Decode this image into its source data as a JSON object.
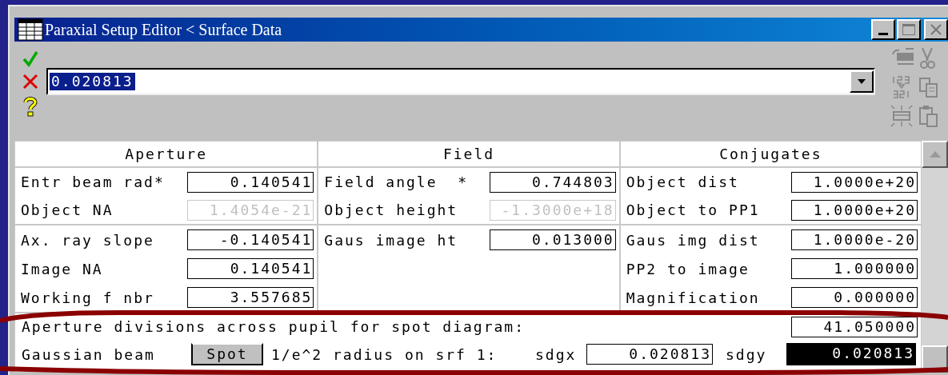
{
  "window": {
    "title": "Paraxial Setup Editor < Surface Data"
  },
  "edit_bar": {
    "value": "0.020813",
    "selected": true
  },
  "sections": [
    {
      "title": "Aperture",
      "groups": [
        [
          {
            "label": "Entr beam rad*",
            "value": "0.140541",
            "disabled": false
          },
          {
            "label": "Object NA",
            "value": "1.4054e-21",
            "disabled": true
          }
        ],
        [
          {
            "label": "Ax. ray slope",
            "value": "-0.140541",
            "disabled": false
          },
          {
            "label": "Image NA",
            "value": "0.140541",
            "disabled": false
          },
          {
            "label": "Working f nbr",
            "value": "3.557685",
            "disabled": false
          }
        ]
      ]
    },
    {
      "title": "Field",
      "groups": [
        [
          {
            "label": "Field angle  *",
            "value": "0.744803",
            "disabled": false
          },
          {
            "label": "Object height",
            "value": "-1.3000e+18",
            "disabled": true
          }
        ],
        [
          {
            "label": "Gaus image ht",
            "value": "0.013000",
            "disabled": false
          }
        ]
      ]
    },
    {
      "title": "Conjugates",
      "groups": [
        [
          {
            "label": "Object dist",
            "value": "1.0000e+20",
            "disabled": false
          },
          {
            "label": "Object to PP1",
            "value": "1.0000e+20",
            "disabled": false
          }
        ],
        [
          {
            "label": "Gaus img dist",
            "value": "1.0000e-20",
            "disabled": false
          },
          {
            "label": "PP2 to image",
            "value": "1.000000",
            "disabled": false
          },
          {
            "label": "Magnification",
            "value": "0.000000",
            "disabled": false
          }
        ]
      ]
    }
  ],
  "spot_divisions": {
    "label": "Aperture divisions across pupil for spot diagram:",
    "value": "41.050000"
  },
  "gaussian": {
    "label": "Gaussian beam",
    "button": "Spot",
    "text": "1/e^2 radius on srf 1:",
    "x_label": "sdgx",
    "x_value": "0.020813",
    "x_selected": false,
    "y_label": "sdgy",
    "y_value": "0.020813",
    "y_selected": true
  }
}
